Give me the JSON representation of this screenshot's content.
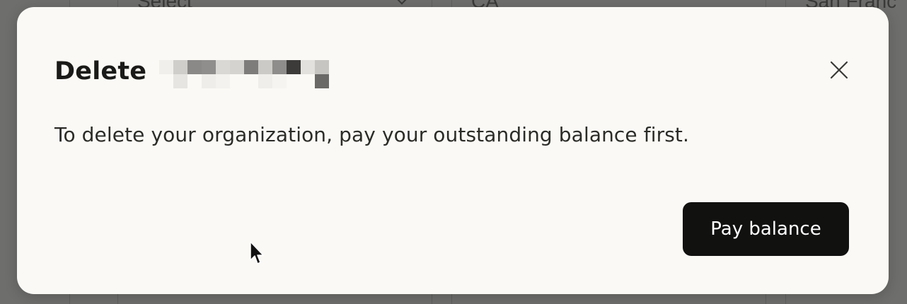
{
  "background": {
    "field_1": "Select",
    "field_2": "CA",
    "field_3": "San Franc"
  },
  "modal": {
    "title": "Delete",
    "body": "To delete your organization, pay your outstanding balance first.",
    "primary_button_label": "Pay balance",
    "close_icon": "close-icon"
  },
  "colors": {
    "modal_background": "#faf9f5",
    "overlay": "#6e6e6c",
    "button_background": "#111110",
    "button_text": "#ffffff",
    "title_text": "#1a1a18"
  }
}
